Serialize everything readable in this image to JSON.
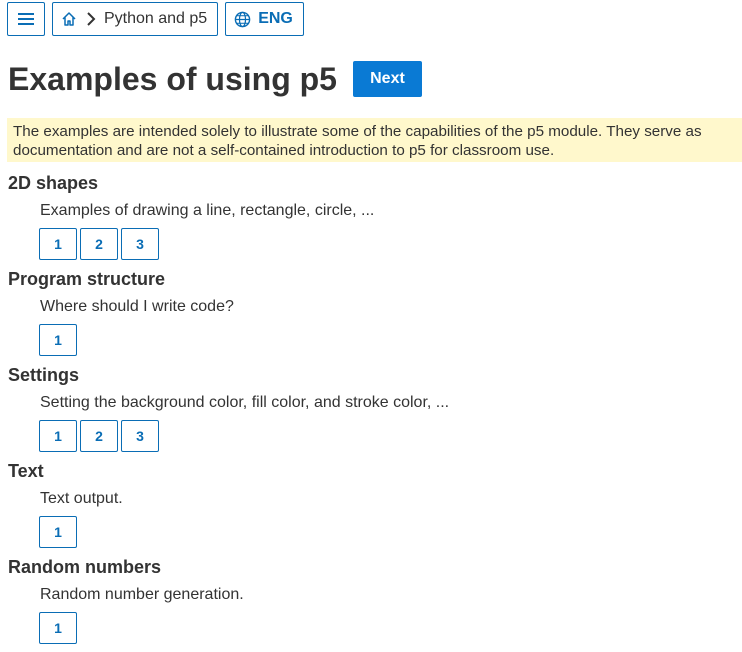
{
  "topbar": {
    "menu_icon": "hamburger-menu-icon",
    "home_icon": "home-icon",
    "chevron_icon": "chevron-right-icon",
    "crumb_label": "Python and p5",
    "globe_icon": "globe-icon",
    "lang_label": "ENG"
  },
  "header": {
    "title": "Examples of using p5",
    "next_label": "Next"
  },
  "notice": {
    "text": "The examples are intended solely to illustrate some of the capabilities of the p5 module. They serve as documentation and are not a self-contained introduction to p5 for classroom use."
  },
  "sections": [
    {
      "title": "2D shapes",
      "description": "Examples of drawing a line, rectangle, circle, ...",
      "examples": [
        "1",
        "2",
        "3"
      ]
    },
    {
      "title": "Program structure",
      "description": "Where should I write code?",
      "examples": [
        "1"
      ]
    },
    {
      "title": "Settings",
      "description": "Setting the background color, fill color, and stroke color, ...",
      "examples": [
        "1",
        "2",
        "3"
      ]
    },
    {
      "title": "Text",
      "description": "Text output.",
      "examples": [
        "1"
      ]
    },
    {
      "title": "Random numbers",
      "description": "Random number generation.",
      "examples": [
        "1"
      ]
    }
  ],
  "colors": {
    "accent": "#0a6db5",
    "button_bg": "#0a7ad4",
    "notice_bg": "#fff8cc",
    "text": "#333333"
  }
}
